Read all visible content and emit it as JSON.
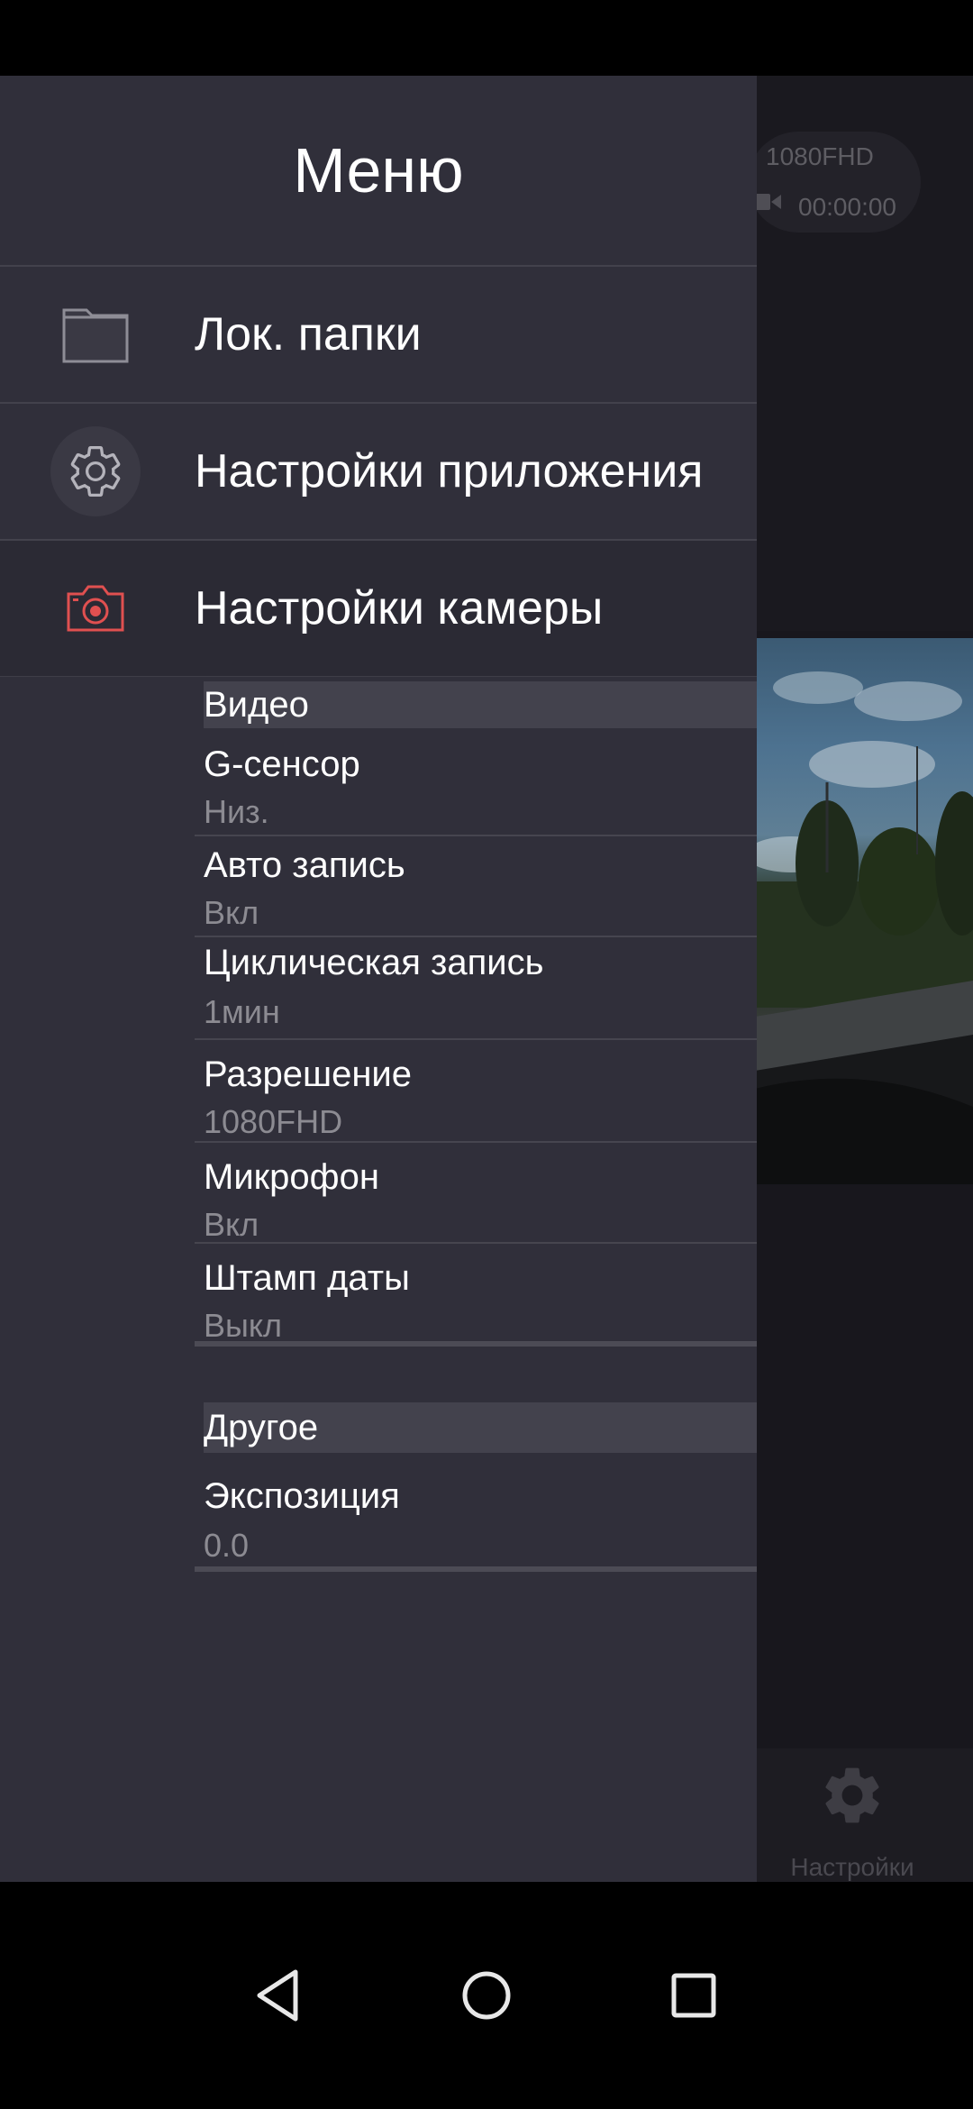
{
  "background_app": {
    "resolution": "1080FHD",
    "recording_time": "00:00:00",
    "bottom_tab_label": "Настройки"
  },
  "drawer": {
    "title": "Меню",
    "items": [
      {
        "label": "Лок. папки",
        "icon": "folder-icon"
      },
      {
        "label": "Настройки приложения",
        "icon": "gear-icon"
      },
      {
        "label": "Настройки камеры",
        "icon": "camera-icon"
      }
    ]
  },
  "camera_settings": {
    "sections": [
      {
        "title": "Видео",
        "rows": [
          {
            "title": "G-сенсор",
            "value": "Низ."
          },
          {
            "title": "Авто запись",
            "value": "Вкл"
          },
          {
            "title": "Циклическая запись",
            "value": "1мин"
          },
          {
            "title": "Разрешение",
            "value": "1080FHD"
          },
          {
            "title": "Микрофон",
            "value": "Вкл"
          },
          {
            "title": "Штамп даты",
            "value": "Выкл"
          }
        ]
      },
      {
        "title": "Другое",
        "rows": [
          {
            "title": "Экспозиция",
            "value": "0.0"
          }
        ]
      }
    ]
  },
  "colors": {
    "drawer_bg": "#302f3a",
    "accent_camera_icon": "#e05050",
    "value_text": "#8c8b92"
  },
  "nav_bar": {
    "icons": [
      "back-icon",
      "home-icon",
      "recents-icon"
    ]
  }
}
